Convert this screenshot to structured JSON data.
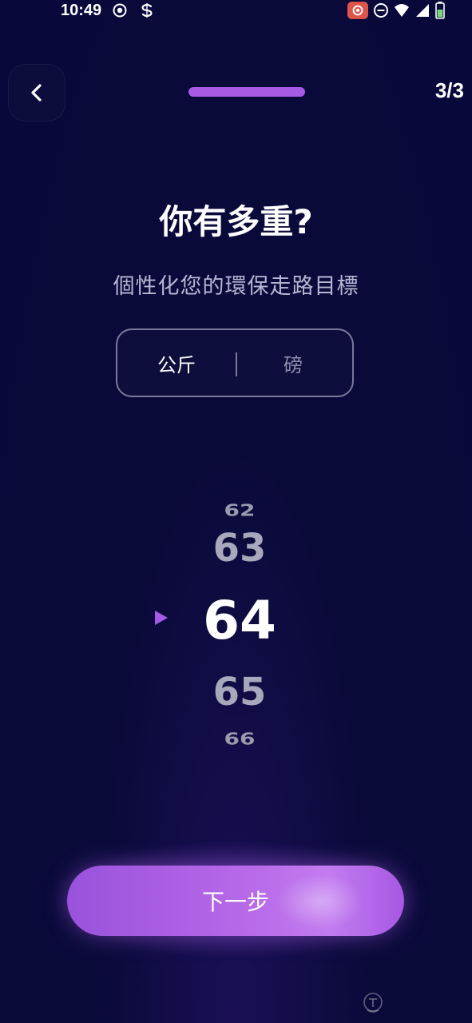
{
  "status_bar": {
    "time": "10:49",
    "left_icons": [
      "record-icon",
      "s-icon"
    ],
    "right_icons": [
      "screen-record-icon",
      "dnd-icon",
      "wifi-icon",
      "signal-icon",
      "battery-icon"
    ]
  },
  "header": {
    "back_icon": "chevron-left-icon",
    "step_counter": "3/3"
  },
  "title": "你有多重?",
  "subtitle": "個性化您的環保走路目標",
  "unit_toggle": {
    "options": [
      "公斤",
      "磅"
    ],
    "selected": "公斤"
  },
  "picker": {
    "values": [
      "62",
      "63",
      "64",
      "65",
      "66"
    ],
    "selected": "64"
  },
  "next_button": {
    "label": "下一步"
  },
  "colors": {
    "background": "#0a0a3a",
    "accent": "#a65ae6",
    "button_gradient_start": "#9a52dc",
    "button_gradient_end": "#c27cf0"
  }
}
